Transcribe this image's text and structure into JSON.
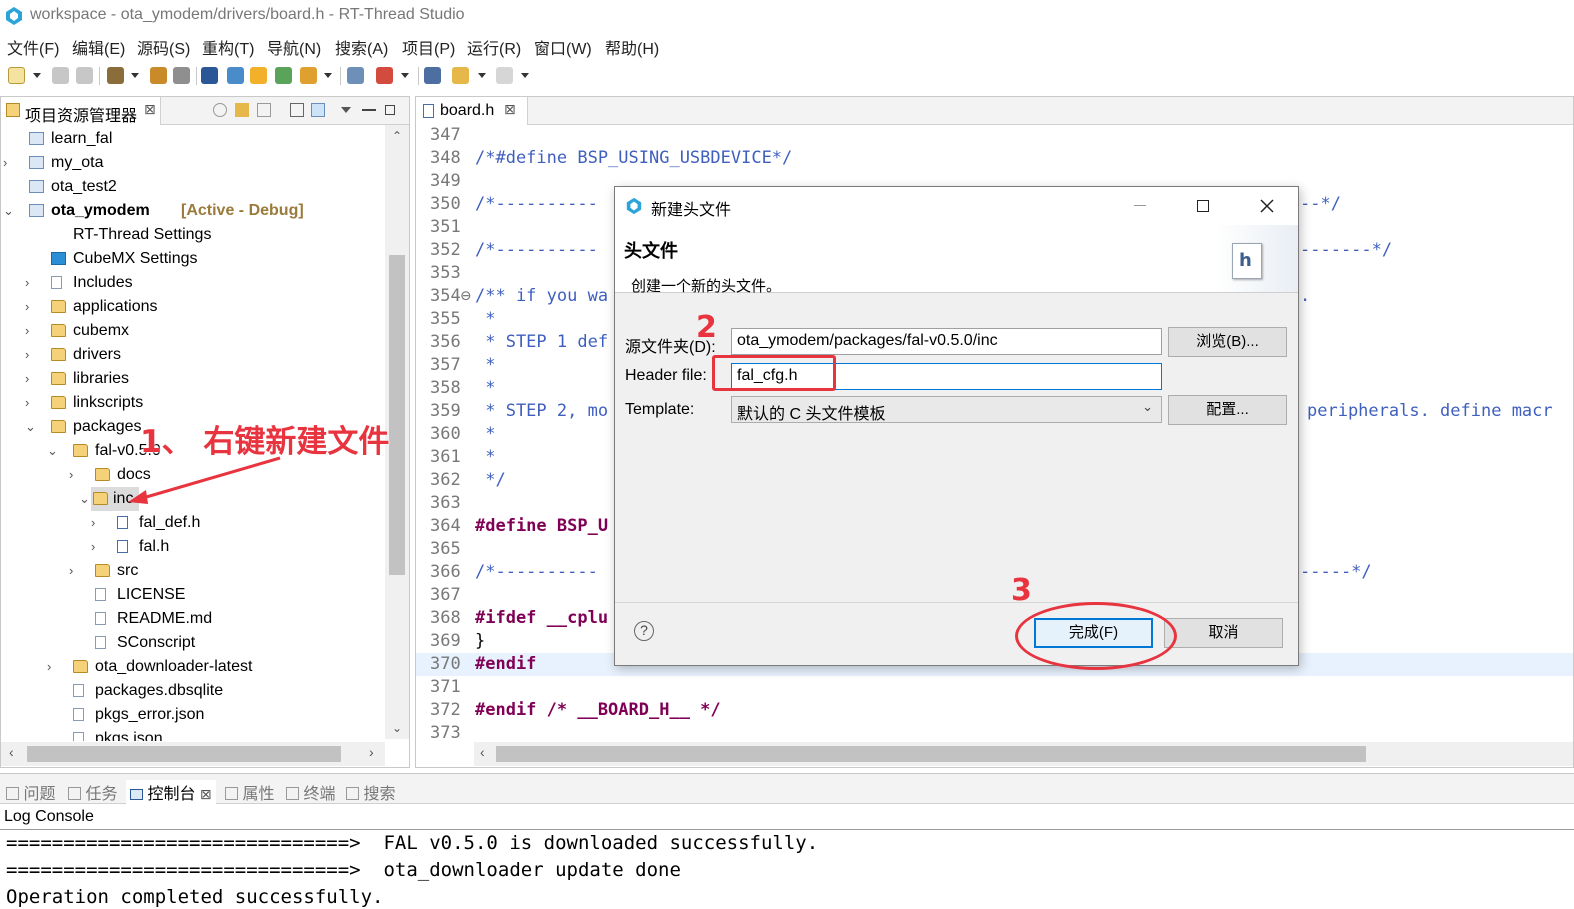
{
  "window": {
    "title": "workspace - ota_ymodem/drivers/board.h - RT-Thread Studio"
  },
  "menu": [
    "文件(F)",
    "编辑(E)",
    "源码(S)",
    "重构(T)",
    "导航(N)",
    "搜索(A)",
    "项目(P)",
    "运行(R)",
    "窗口(W)",
    "帮助(H)"
  ],
  "explorer": {
    "tab_label": "项目资源管理器",
    "tab_close": "⊠",
    "tree": [
      {
        "label": "learn_fal",
        "arrow": "",
        "icon": "project"
      },
      {
        "label": "my_ota",
        "arrow": "›",
        "icon": "project"
      },
      {
        "label": "ota_test2",
        "arrow": "",
        "icon": "project"
      },
      {
        "label": "ota_ymodem",
        "arrow": "⌄",
        "icon": "project",
        "suffix": "[Active - Debug]"
      },
      {
        "label": "RT-Thread Settings",
        "arrow": "",
        "icon": "rt"
      },
      {
        "label": "CubeMX Settings",
        "arrow": "",
        "icon": "mx"
      },
      {
        "label": "Includes",
        "arrow": "›",
        "icon": "includes"
      },
      {
        "label": "applications",
        "arrow": "›",
        "icon": "folder"
      },
      {
        "label": "cubemx",
        "arrow": "›",
        "icon": "folder"
      },
      {
        "label": "drivers",
        "arrow": "›",
        "icon": "folder"
      },
      {
        "label": "libraries",
        "arrow": "›",
        "icon": "folder"
      },
      {
        "label": "linkscripts",
        "arrow": "›",
        "icon": "folder"
      },
      {
        "label": "packages",
        "arrow": "⌄",
        "icon": "folder"
      },
      {
        "label": "fal-v0.5.0",
        "arrow": "⌄",
        "icon": "folder"
      },
      {
        "label": "docs",
        "arrow": "›",
        "icon": "folder"
      },
      {
        "label": "inc",
        "arrow": "⌄",
        "icon": "folder"
      },
      {
        "label": "fal_def.h",
        "arrow": "›",
        "icon": "hfile"
      },
      {
        "label": "fal.h",
        "arrow": "›",
        "icon": "hfile"
      },
      {
        "label": "src",
        "arrow": "›",
        "icon": "folder"
      },
      {
        "label": "LICENSE",
        "arrow": "",
        "icon": "file"
      },
      {
        "label": "README.md",
        "arrow": "",
        "icon": "file"
      },
      {
        "label": "SConscript",
        "arrow": "",
        "icon": "file"
      },
      {
        "label": "ota_downloader-latest",
        "arrow": "›",
        "icon": "folder"
      },
      {
        "label": "packages.dbsqlite",
        "arrow": "",
        "icon": "file"
      },
      {
        "label": "pkgs_error.json",
        "arrow": "",
        "icon": "file"
      },
      {
        "label": "pkgs.json",
        "arrow": "",
        "icon": "file"
      }
    ]
  },
  "editor": {
    "tab_label": "board.h",
    "tab_close": "⊠",
    "lines": [
      {
        "n": "347",
        "text": ""
      },
      {
        "n": "348",
        "text": "/*#define BSP_USING_USBDEVICE*/",
        "cls": "c-cm"
      },
      {
        "n": "349",
        "text": ""
      },
      {
        "n": "350",
        "text": "/*----------",
        "cls": "c-cm",
        "tail": "--*/"
      },
      {
        "n": "351",
        "text": ""
      },
      {
        "n": "352",
        "text": "/*----------",
        "cls": "c-cm",
        "tail": "-------*/"
      },
      {
        "n": "353",
        "text": ""
      },
      {
        "n": "354⊖",
        "text": "/** if you wa",
        "cls": "c-cm",
        "tail": "."
      },
      {
        "n": "355",
        "text": " *",
        "cls": "c-cm"
      },
      {
        "n": "356",
        "text": " * STEP 1 def",
        "cls": "c-cm"
      },
      {
        "n": "357",
        "text": " *",
        "cls": "c-cm"
      },
      {
        "n": "358",
        "text": " *",
        "cls": "c-cm"
      },
      {
        "n": "359",
        "text": " * STEP 2, mo",
        "cls": "c-cm",
        "tail": "peripherals. define macr"
      },
      {
        "n": "360",
        "text": " *",
        "cls": "c-cm"
      },
      {
        "n": "361",
        "text": " *",
        "cls": "c-cm"
      },
      {
        "n": "362",
        "text": " */",
        "cls": "c-cm"
      },
      {
        "n": "363",
        "text": ""
      },
      {
        "n": "364",
        "text": "#define BSP_U",
        "cls": "kwline"
      },
      {
        "n": "365",
        "text": ""
      },
      {
        "n": "366",
        "text": "/*----------",
        "cls": "c-cm",
        "tail": "-----*/"
      },
      {
        "n": "367",
        "text": ""
      },
      {
        "n": "368",
        "text": "#ifdef __cplu",
        "cls": "kwline2"
      },
      {
        "n": "369",
        "text": "}"
      },
      {
        "n": "370",
        "text": "#endif",
        "cls": "c-kw",
        "hl": true
      },
      {
        "n": "371",
        "text": ""
      },
      {
        "n": "372",
        "text": "#endif /* __BOARD_H__ */",
        "cls": "endifline"
      },
      {
        "n": "373",
        "text": ""
      }
    ]
  },
  "console": {
    "tabs": [
      "问题",
      "任务",
      "控制台",
      "属性",
      "终端",
      "搜索"
    ],
    "active_tab": "控制台",
    "title": "Log Console",
    "lines": [
      "==============================>  FAL v0.5.0 is downloaded successfully.",
      "==============================>  ota_downloader update done",
      "Operation completed successfully."
    ]
  },
  "dialog": {
    "title": "新建头文件",
    "heading": "头文件",
    "description": "创建一个新的头文件。",
    "source_folder_label": "源文件夹(D):",
    "source_folder_value": "ota_ymodem/packages/fal-v0.5.0/inc",
    "browse_button": "浏览(B)...",
    "header_file_label": "Header file:",
    "header_file_value": "fal_cfg.h",
    "template_label": "Template:",
    "template_value": "默认的 C 头文件模板",
    "configure_button": "配置...",
    "finish_button": "完成(F)",
    "cancel_button": "取消",
    "help_icon": "?"
  },
  "annotations": {
    "step1": "1、 右键新建文件",
    "step2": "2",
    "step3": "3",
    "color": "#e8343f"
  }
}
